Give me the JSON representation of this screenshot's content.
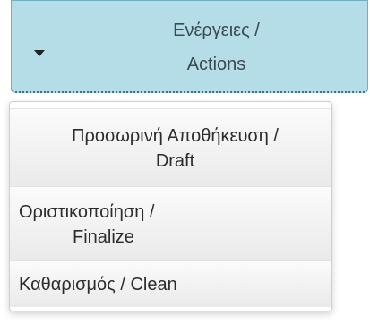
{
  "toggle": {
    "label_line1": "Ενέργειες /",
    "label_line2": "Actions"
  },
  "menu": {
    "items": [
      {
        "line1": "Προσωρινή Αποθήκευση /",
        "line2": "Draft"
      },
      {
        "line1": "Οριστικοποίηση /",
        "line2": "Finalize"
      },
      {
        "line1": "Καθαρισμός / Clean"
      }
    ]
  },
  "colors": {
    "toggle_background": "#b5dde8",
    "toggle_border": "#6fb0c4"
  },
  "icons": {
    "caret": "caret-down-icon"
  }
}
